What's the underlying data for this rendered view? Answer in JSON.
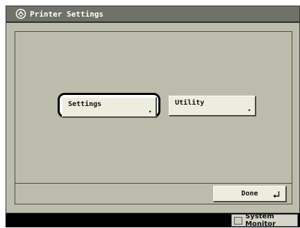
{
  "window": {
    "title": "Printer Settings",
    "title_icon": "printer-settings-icon"
  },
  "main": {
    "buttons": [
      {
        "label": "Settings",
        "arrow": "▸",
        "selected": true
      },
      {
        "label": "Utility",
        "arrow": "▸",
        "selected": false
      }
    ]
  },
  "footer": {
    "done_label": "Done",
    "done_icon": "enter-return-icon"
  },
  "status_bar": {
    "system_monitor_label": "System Monitor"
  },
  "colors": {
    "screen_bg": "#bdbdad",
    "titlebar_bg": "#6f7268",
    "button_face": "#ececdf",
    "focus_ring": "#000000",
    "status_bar_bg": "#000000"
  }
}
